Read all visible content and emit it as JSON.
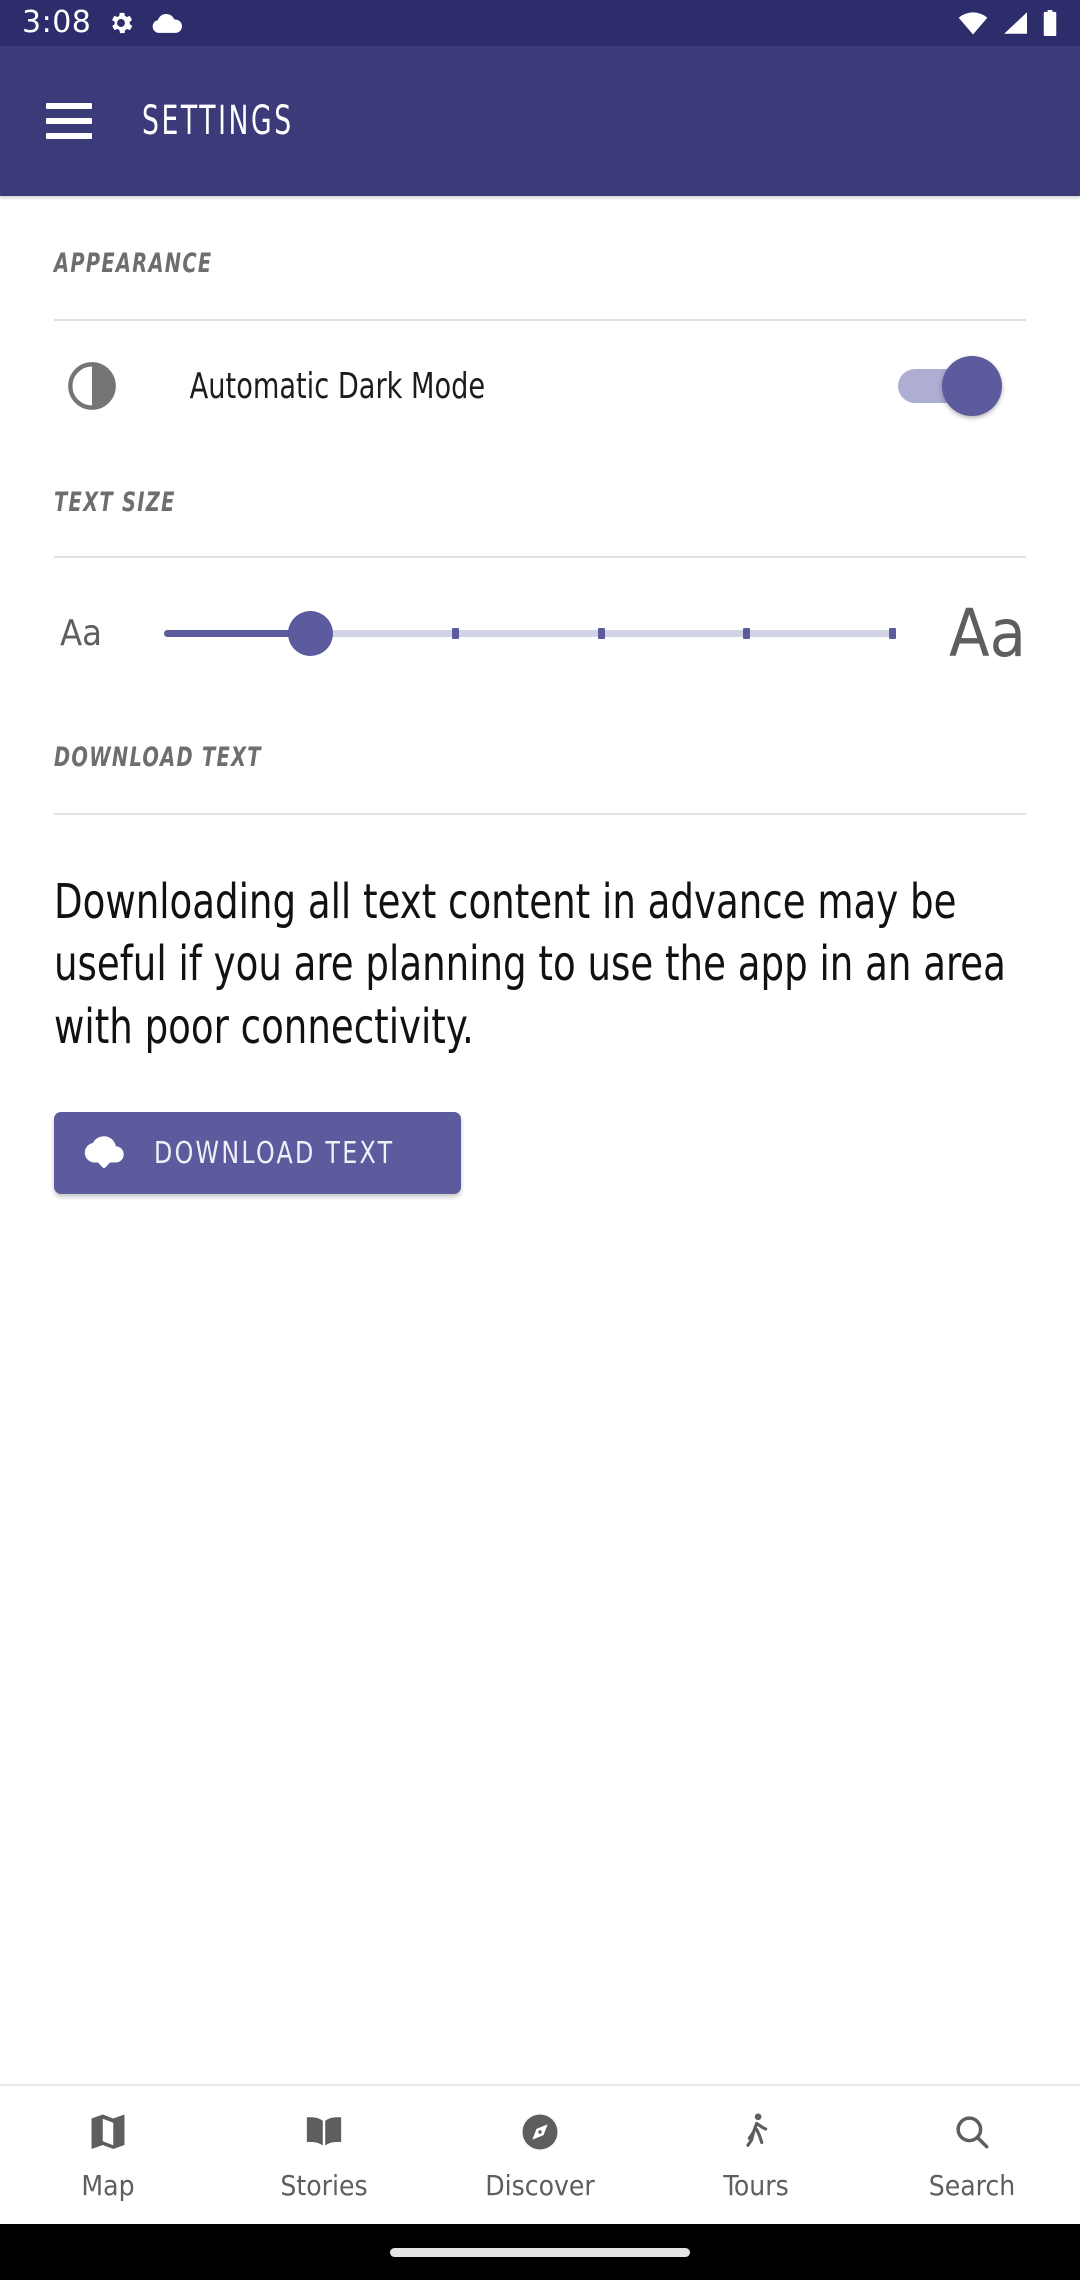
{
  "status_bar": {
    "time": "3:08",
    "icons_left": [
      "gear-icon",
      "cloud-icon"
    ],
    "icons_right": [
      "wifi-icon",
      "cell-signal-icon",
      "battery-icon"
    ]
  },
  "app_bar": {
    "menu_icon": "hamburger-menu-icon",
    "title": "SETTINGS",
    "background_color": "#3b3b7a"
  },
  "appearance": {
    "heading": "APPEARANCE",
    "dark_mode": {
      "icon": "contrast-half-circle-icon",
      "label": "Automatic Dark Mode",
      "enabled": true,
      "track_color": "#aeaed4",
      "thumb_color": "#5b5b9e"
    }
  },
  "text_size": {
    "heading": "TEXT SIZE",
    "small_label": "Aa",
    "large_label": "Aa",
    "slider": {
      "value": 1,
      "min": 0,
      "max": 5,
      "tick_count": 6,
      "accent_color": "#5b5b9e",
      "track_color": "#d3d3e6"
    }
  },
  "download_text": {
    "heading": "DOWNLOAD TEXT",
    "description": "Downloading all text content in advance may be useful if you are planning to use the app in an area with poor connectivity.",
    "button": {
      "icon": "cloud-download-icon",
      "label": "DOWNLOAD TEXT",
      "background_color": "#5b5b9e"
    }
  },
  "bottom_nav": {
    "items": [
      {
        "label": "Map",
        "icon": "map-icon"
      },
      {
        "label": "Stories",
        "icon": "book-icon"
      },
      {
        "label": "Discover",
        "icon": "compass-icon"
      },
      {
        "label": "Tours",
        "icon": "walking-person-icon"
      },
      {
        "label": "Search",
        "icon": "search-icon"
      }
    ],
    "icon_color": "#5e5e5e"
  }
}
